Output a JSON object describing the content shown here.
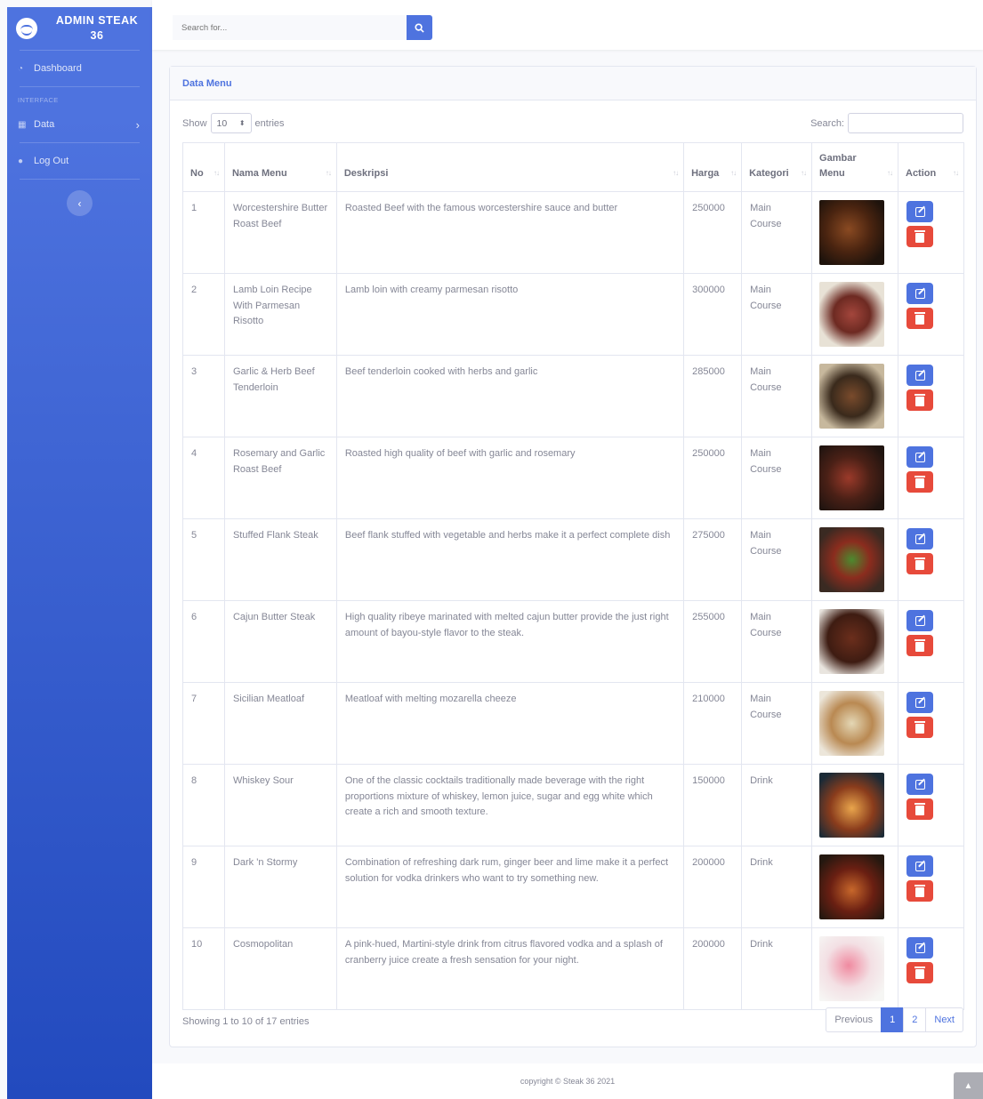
{
  "brand": {
    "line1": "ADMIN STEAK",
    "line2": "36"
  },
  "sidebar": {
    "dashboard": "Dashboard",
    "heading": "INTERFACE",
    "data": "Data",
    "logout": "Log Out"
  },
  "topbar": {
    "search_placeholder": "Search for..."
  },
  "card": {
    "title": "Data Menu"
  },
  "controls": {
    "show": "Show",
    "entries_value": "10",
    "entries": "entries",
    "search": "Search:"
  },
  "table": {
    "headers": [
      "No",
      "Nama Menu",
      "Deskripsi",
      "Harga",
      "Kategori",
      "Gambar Menu",
      "Action"
    ],
    "rows": [
      {
        "no": "1",
        "name": "Worcestershire Butter Roast Beef",
        "desc": "Roasted Beef with the famous worcestershire sauce and butter",
        "price": "250000",
        "cat": "Main Course"
      },
      {
        "no": "2",
        "name": "Lamb Loin Recipe With Parmesan Risotto",
        "desc": "Lamb loin with creamy parmesan risotto",
        "price": "300000",
        "cat": "Main Course"
      },
      {
        "no": "3",
        "name": "Garlic & Herb Beef Tenderloin",
        "desc": "Beef tenderloin cooked with herbs and garlic",
        "price": "285000",
        "cat": "Main Course"
      },
      {
        "no": "4",
        "name": "Rosemary and Garlic Roast Beef",
        "desc": "Roasted high quality of beef with garlic and rosemary",
        "price": "250000",
        "cat": "Main Course"
      },
      {
        "no": "5",
        "name": "Stuffed Flank Steak",
        "desc": "Beef flank stuffed with vegetable and herbs make it a perfect complete dish",
        "price": "275000",
        "cat": "Main Course"
      },
      {
        "no": "6",
        "name": "Cajun Butter Steak",
        "desc": "High quality ribeye marinated with melted cajun butter provide the just right amount of bayou-style flavor to the steak.",
        "price": "255000",
        "cat": "Main Course"
      },
      {
        "no": "7",
        "name": "Sicilian Meatloaf",
        "desc": "Meatloaf with melting mozarella cheeze",
        "price": "210000",
        "cat": "Main Course"
      },
      {
        "no": "8",
        "name": "Whiskey Sour",
        "desc": "One of the classic cocktails traditionally made beverage with the right proportions mixture of whiskey, lemon juice, sugar and egg white which create a rich and smooth texture.",
        "price": "150000",
        "cat": "Drink"
      },
      {
        "no": "9",
        "name": "Dark 'n Stormy",
        "desc": "Combination of refreshing dark rum, ginger beer and lime make it a perfect solution for vodka drinkers who want to try something new.",
        "price": "200000",
        "cat": "Drink"
      },
      {
        "no": "10",
        "name": "Cosmopolitan",
        "desc": "A pink-hued, Martini-style drink from citrus flavored vodka and a splash of cranberry juice create a fresh sensation for your night.",
        "price": "200000",
        "cat": "Drink"
      }
    ]
  },
  "footer_info": "Showing 1 to 10 of 17 entries",
  "pager": {
    "prev": "Previous",
    "p1": "1",
    "p2": "2",
    "next": "Next"
  },
  "copyright": "copyright © Steak 36 2021",
  "colors": {
    "primary": "#4e73df",
    "danger": "#e74a3b"
  }
}
